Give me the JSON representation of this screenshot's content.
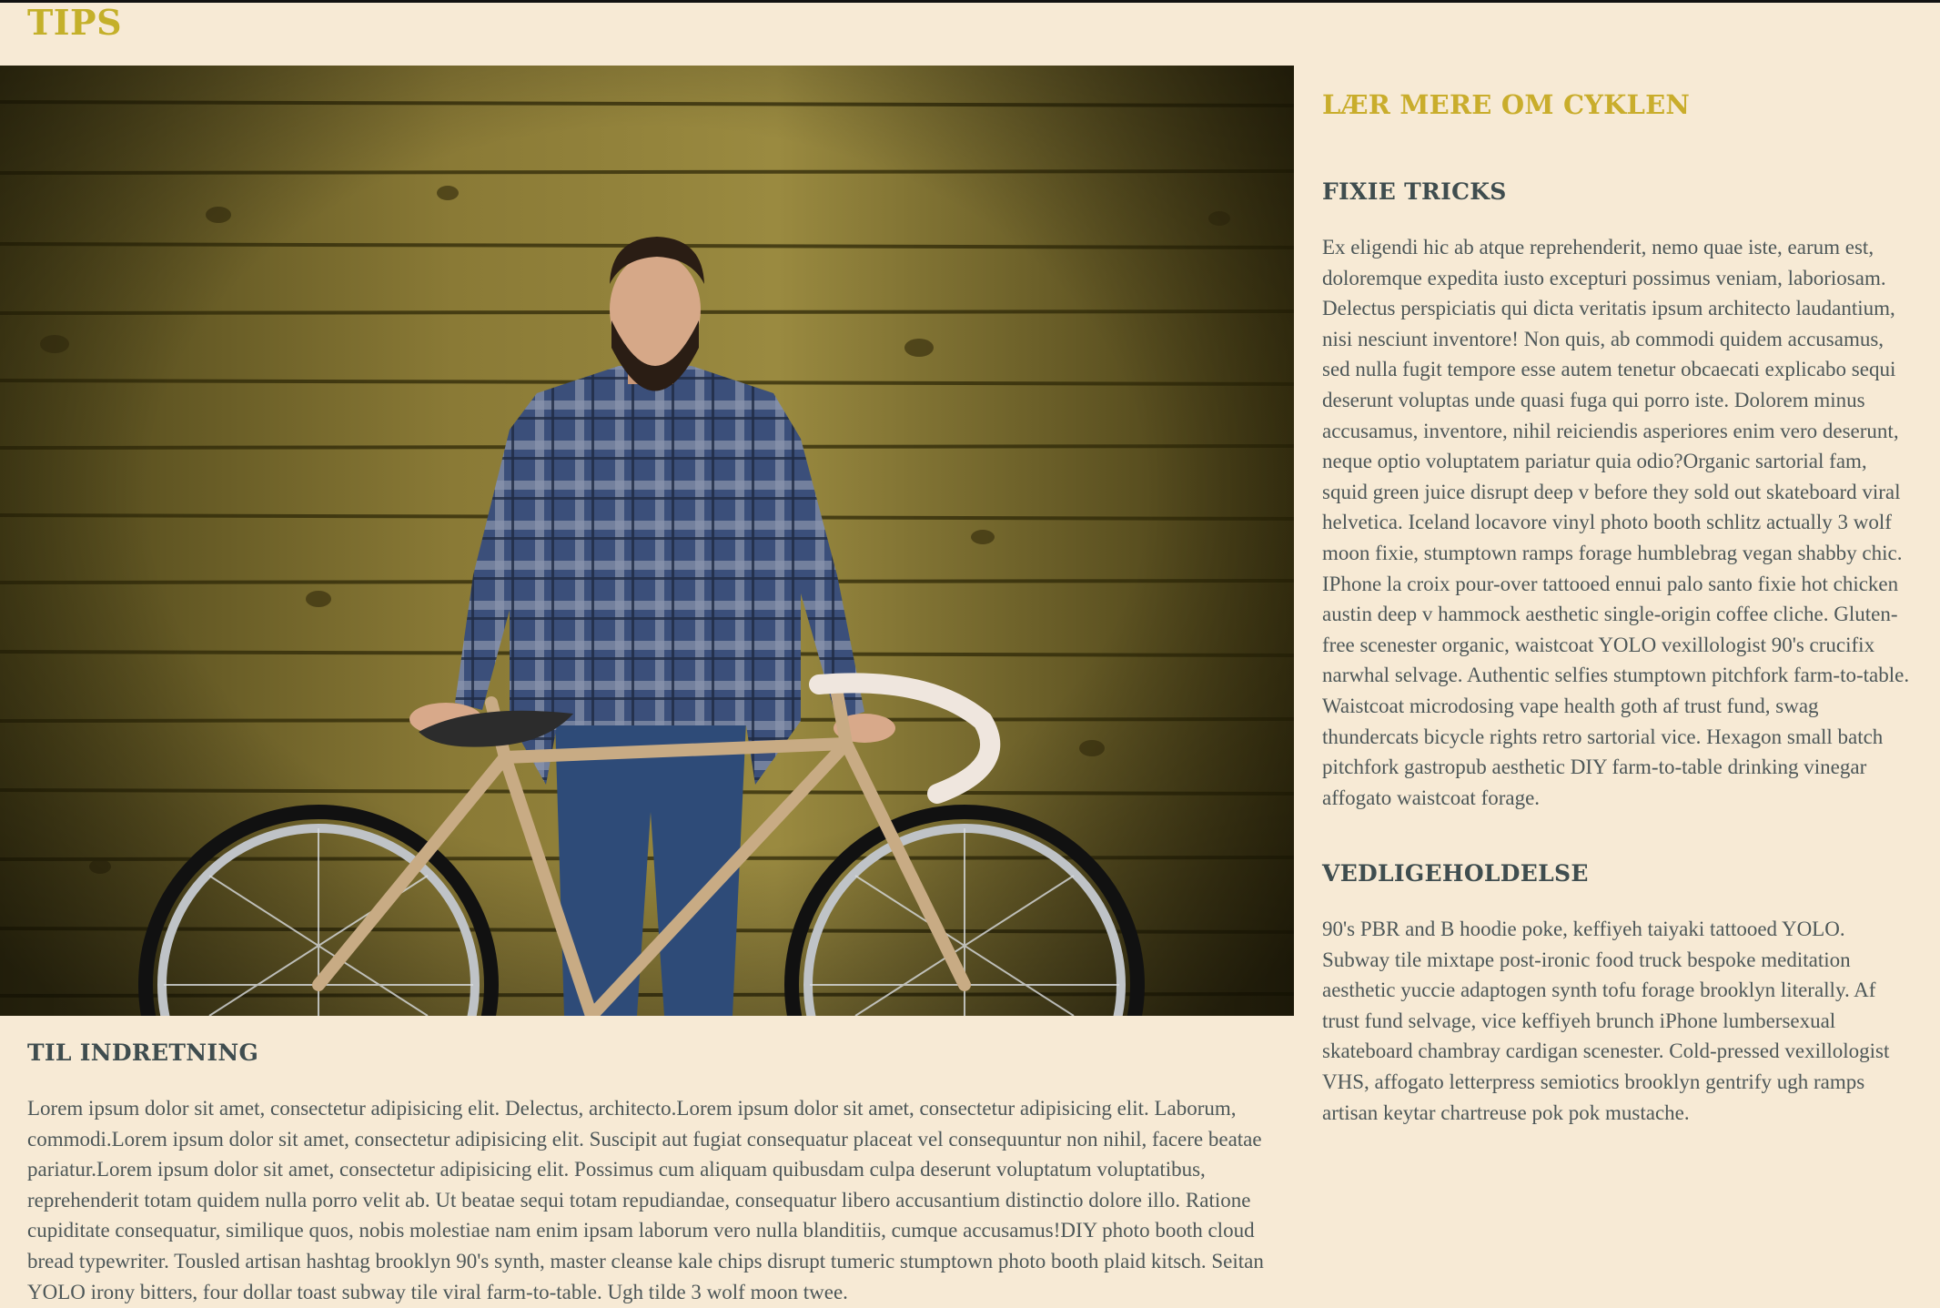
{
  "page": {
    "title": "TIPS"
  },
  "hero": {
    "image_icon": "man-with-fixie-bicycle-photo"
  },
  "left_article": {
    "heading": "TIL INDRETNING",
    "body": "Lorem ipsum dolor sit amet, consectetur adipisicing elit. Delectus, architecto.Lorem ipsum dolor sit amet, consectetur adipisicing elit. Laborum, commodi.Lorem ipsum dolor sit amet, consectetur adipisicing elit. Suscipit aut fugiat consequatur placeat vel consequuntur non nihil, facere beatae pariatur.Lorem ipsum dolor sit amet, consectetur adipisicing elit. Possimus cum aliquam quibusdam culpa deserunt voluptatum voluptatibus, reprehenderit totam quidem nulla porro velit ab. Ut beatae sequi totam repudiandae, consequatur libero accusantium distinctio dolore illo. Ratione cupiditate consequatur, similique quos, nobis molestiae nam enim ipsam laborum vero nulla blanditiis, cumque accusamus!DIY photo booth cloud bread typewriter. Tousled artisan hashtag brooklyn 90's synth, master cleanse kale chips disrupt tumeric stumptown photo booth plaid kitsch. Seitan YOLO irony bitters, four dollar toast subway tile viral farm-to-table. Ugh tilde 3 wolf moon twee."
  },
  "sidebar": {
    "title": "LÆR MERE OM CYKLEN",
    "sections": [
      {
        "heading": "FIXIE TRICKS",
        "body": "Ex eligendi hic ab atque reprehenderit, nemo quae iste, earum est, doloremque expedita iusto excepturi possimus veniam, laboriosam. Delectus perspiciatis qui dicta veritatis ipsum architecto laudantium, nisi nesciunt inventore! Non quis, ab commodi quidem accusamus, sed nulla fugit tempore esse autem tenetur obcaecati explicabo sequi deserunt voluptas unde quasi fuga qui porro iste. Dolorem minus accusamus, inventore, nihil reiciendis asperiores enim vero deserunt, neque optio voluptatem pariatur quia odio?Organic sartorial fam, squid green juice disrupt deep v before they sold out skateboard viral helvetica. Iceland locavore vinyl photo booth schlitz actually 3 wolf moon fixie, stumptown ramps forage humblebrag vegan shabby chic. IPhone la croix pour-over tattooed ennui palo santo fixie hot chicken austin deep v hammock aesthetic single-origin coffee cliche. Gluten-free scenester organic, waistcoat YOLO vexillologist 90's crucifix narwhal selvage. Authentic selfies stumptown pitchfork farm-to-table. Waistcoat microdosing vape health goth af trust fund, swag thundercats bicycle rights retro sartorial vice. Hexagon small batch pitchfork gastropub aesthetic DIY farm-to-table drinking vinegar affogato waistcoat forage."
      },
      {
        "heading": "VEDLIGEHOLDELSE",
        "body": "90's PBR and B hoodie poke, keffiyeh taiyaki tattooed YOLO. Subway tile mixtape post-ironic food truck bespoke meditation aesthetic yuccie adaptogen synth tofu forage brooklyn literally. Af trust fund selvage, vice keffiyeh brunch iPhone lumbersexual skateboard chambray cardigan scenester. Cold-pressed vexillologist VHS, affogato letterpress semiotics brooklyn gentrify ugh ramps artisan keytar chartreuse pok pok mustache."
      }
    ]
  },
  "colors": {
    "background": "#f7ead5",
    "accent_gold": "#c9ad2c",
    "heading_slate": "#3f4d4f",
    "body_text": "#4d5758"
  }
}
